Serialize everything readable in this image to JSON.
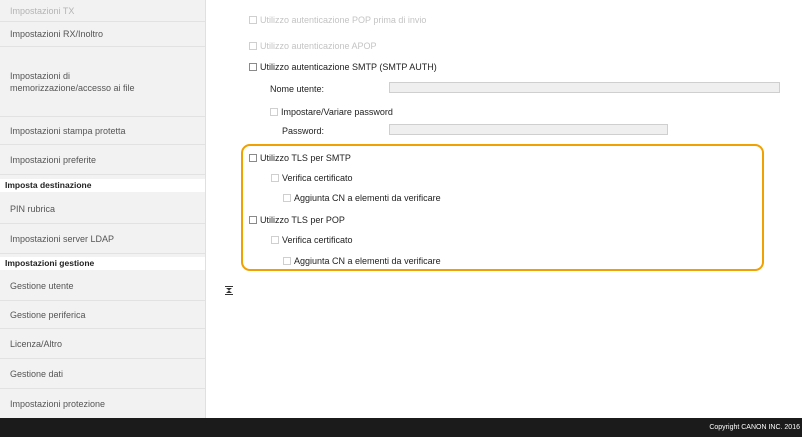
{
  "sidebar": {
    "items": [
      {
        "label": "Impostazioni TX"
      },
      {
        "label": "Impostazioni RX/Inoltro"
      },
      {
        "label": "Impostazioni di memorizzazione/accesso ai file"
      },
      {
        "label": "Impostazioni stampa protetta"
      },
      {
        "label": "Impostazioni preferite"
      }
    ],
    "section_destinazione": "Imposta destinazione",
    "destinazione_items": [
      {
        "label": "PIN rubrica"
      },
      {
        "label": "Impostazioni server LDAP"
      }
    ],
    "section_gestione": "Impostazioni gestione",
    "gestione_items": [
      {
        "label": "Gestione utente"
      },
      {
        "label": "Gestione periferica"
      },
      {
        "label": "Licenza/Altro"
      },
      {
        "label": "Gestione dati"
      },
      {
        "label": "Impostazioni protezione"
      }
    ]
  },
  "form": {
    "pop_auth_before_send": {
      "label": "Utilizzo autenticazione POP prima di invio",
      "checked": false
    },
    "apop_auth": {
      "label": "Utilizzo autenticazione APOP",
      "checked": false
    },
    "smtp_auth": {
      "label": "Utilizzo autenticazione SMTP (SMTP AUTH)",
      "checked": false
    },
    "username": {
      "label": "Nome utente:",
      "value": ""
    },
    "set_change_password": {
      "label": "Impostare/Variare password",
      "checked": false
    },
    "password": {
      "label": "Password:",
      "value": ""
    },
    "tls_smtp": {
      "label": "Utilizzo TLS per SMTP",
      "checked": false
    },
    "tls_smtp_verify": {
      "label": "Verifica certificato",
      "checked": false
    },
    "tls_smtp_add_cn": {
      "label": "Aggiunta CN a elementi da verificare",
      "checked": false
    },
    "tls_pop": {
      "label": "Utilizzo TLS per POP",
      "checked": false
    },
    "tls_pop_verify": {
      "label": "Verifica certificato",
      "checked": false
    },
    "tls_pop_add_cn": {
      "label": "Aggiunta CN a elementi da verificare",
      "checked": false
    }
  },
  "footer": {
    "copyright": "Copyright CANON INC. 2016"
  },
  "colors": {
    "highlight": "#f0a000",
    "footer_bg": "#1b1b1b",
    "sidebar_bg": "#f2f2f2"
  },
  "icons": {
    "collapse": "collapse-arrows-icon"
  }
}
